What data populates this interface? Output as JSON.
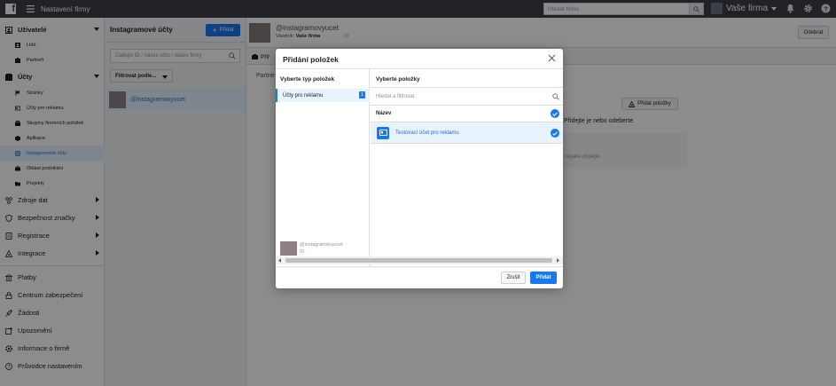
{
  "topbar": {
    "title": "Nastavení firmy",
    "search_placeholder": "Hledat firmu",
    "business_name": "Vaše firma"
  },
  "sidebar": {
    "users": "Uživatelé",
    "people": "Lidé",
    "partners": "Partneři",
    "accounts": "Účty",
    "pages": "Stránky",
    "ad_accounts": "Účty pro reklamu",
    "business_asset_groups": "Skupiny firemních položek",
    "apps": "Aplikace",
    "instagram_accounts": "Instagramové účty",
    "line_of_business": "Oblast podnikání",
    "projects": "Projekty",
    "data_sources": "Zdroje dat",
    "brand_safety": "Bezpečnost značky",
    "registrations": "Registrace",
    "integrations": "Integrace",
    "payments": "Platby",
    "security_center": "Centrum zabezpečení",
    "requests": "Žádosti",
    "notifications": "Upozornění",
    "business_info": "Informace o firmě",
    "setup_guide": "Průvodce nastavením"
  },
  "column": {
    "title": "Instagramové účty",
    "add_label": "Přidat",
    "search_placeholder": "Zadejte ID / název účtu / název firmy",
    "filter_label": "Filtrovat podle...",
    "account_name": "@instagramovyucet"
  },
  "main": {
    "account_name": "@instagramovyucet",
    "owner_label": "Vlastník:",
    "owner_value": "Vaše firma",
    "id_label": "ID",
    "remove_label": "Odebrat",
    "share_label": "Přiř",
    "subtab": "Partne",
    "assign_label": "Přidat položky",
    "hint1": "Přidejte je nebo odeberte",
    "hint2": "y, tak nějaké přidejte."
  },
  "modal": {
    "title": "Přidání položek",
    "left_header": "Vyberte typ položek",
    "left_item": "Účty pro reklamu",
    "left_badge": "1",
    "left_foot_name": "@instagramovyucet",
    "left_foot_id": "ID",
    "right_header": "Vyberte položky",
    "search_placeholder": "Hledat a filtrovat",
    "column_name": "Název",
    "item_name": "Testovací účet pro reklamu",
    "cancel_label": "Zrušit",
    "add_label": "Přidat"
  },
  "colors": {
    "accent": "#1877f2",
    "topbar": "#3b3f4a",
    "active_bg": "#e7f3ff"
  }
}
